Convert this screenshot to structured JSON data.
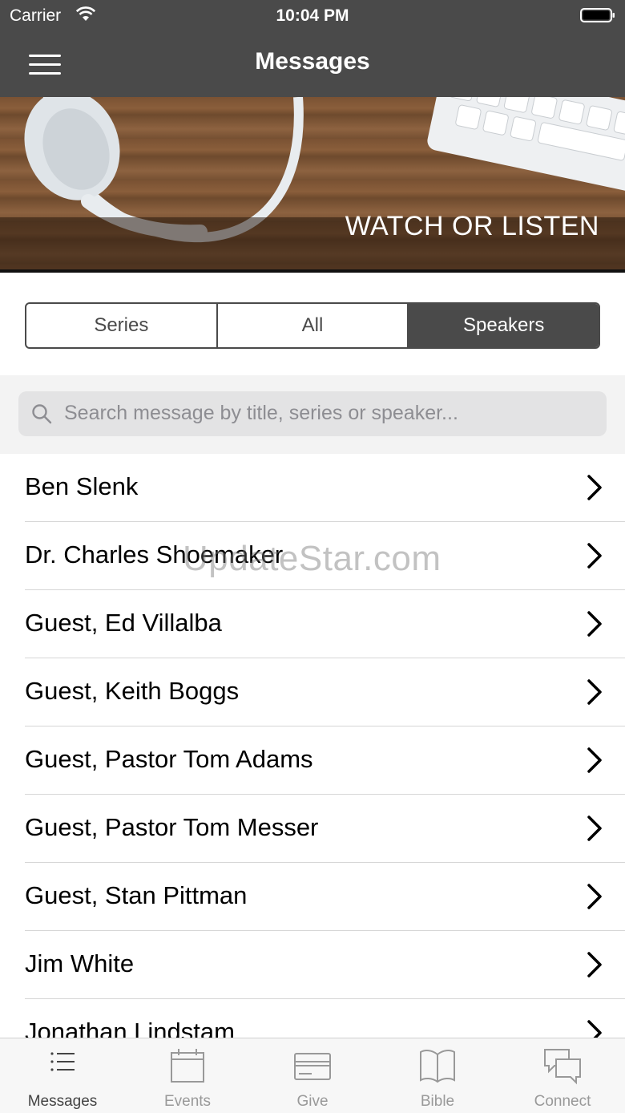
{
  "status_bar": {
    "carrier": "Carrier",
    "time": "10:04 PM"
  },
  "nav": {
    "title": "Messages"
  },
  "banner": {
    "caption": "WATCH OR LISTEN"
  },
  "segments": [
    {
      "label": "Series",
      "active": false
    },
    {
      "label": "All",
      "active": false
    },
    {
      "label": "Speakers",
      "active": true
    }
  ],
  "search": {
    "placeholder": "Search message by title, series or speaker..."
  },
  "speakers": [
    "Ben Slenk",
    "Dr. Charles Shoemaker",
    "Guest, Ed Villalba",
    "Guest, Keith Boggs",
    "Guest, Pastor Tom Adams",
    "Guest, Pastor Tom Messer",
    "Guest, Stan Pittman",
    "Jim White",
    "Jonathan Lindstam"
  ],
  "watermark": "UpdateStar.com",
  "tabs": [
    {
      "label": "Messages",
      "icon": "list-icon",
      "active": true
    },
    {
      "label": "Events",
      "icon": "calendar-icon",
      "active": false
    },
    {
      "label": "Give",
      "icon": "card-icon",
      "active": false
    },
    {
      "label": "Bible",
      "icon": "book-icon",
      "active": false
    },
    {
      "label": "Connect",
      "icon": "chat-icon",
      "active": false
    }
  ]
}
